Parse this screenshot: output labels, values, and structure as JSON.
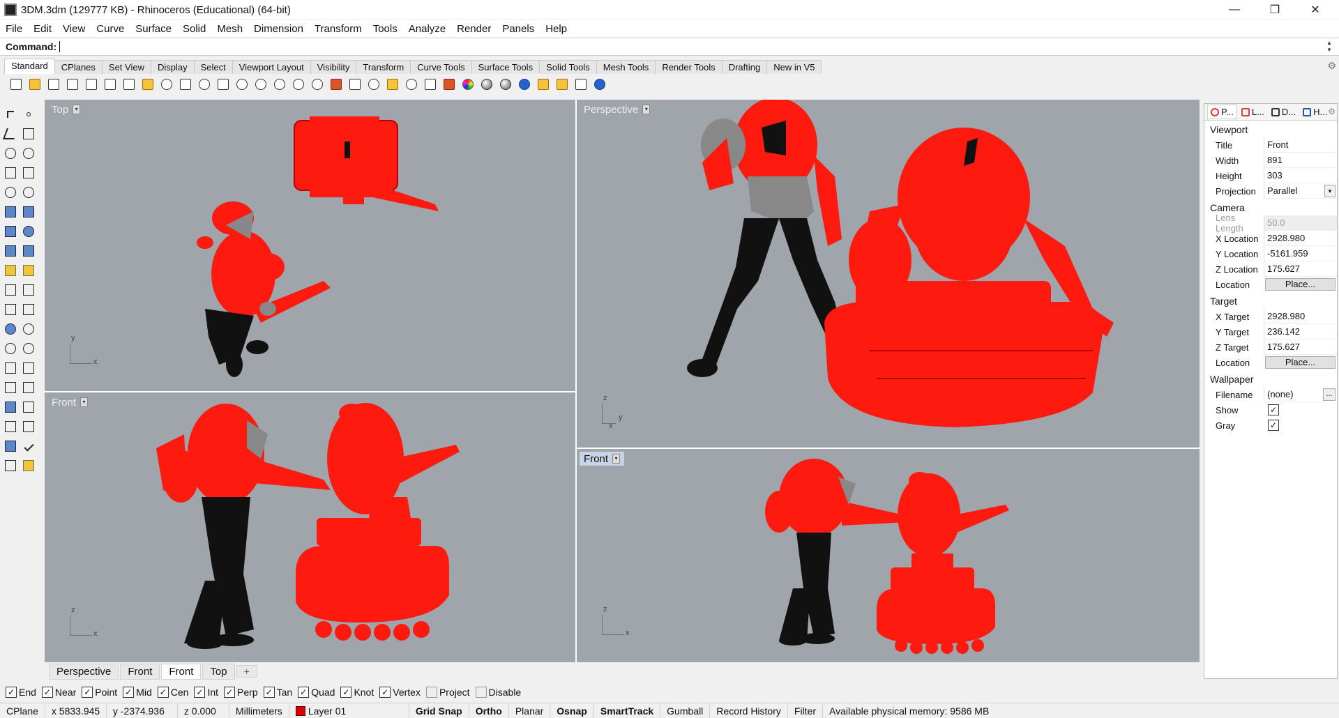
{
  "window": {
    "title": "3DM.3dm (129777 KB) - Rhinoceros (Educational) (64-bit)",
    "minimize": "—",
    "maximize": "❐",
    "close": "✕"
  },
  "menu": [
    "File",
    "Edit",
    "View",
    "Curve",
    "Surface",
    "Solid",
    "Mesh",
    "Dimension",
    "Transform",
    "Tools",
    "Analyze",
    "Render",
    "Panels",
    "Help"
  ],
  "command": {
    "label": "Command:",
    "value": ""
  },
  "toolbar_tabs": [
    "Standard",
    "CPlanes",
    "Set View",
    "Display",
    "Select",
    "Viewport Layout",
    "Visibility",
    "Transform",
    "Curve Tools",
    "Surface Tools",
    "Solid Tools",
    "Mesh Tools",
    "Render Tools",
    "Drafting",
    "New in V5"
  ],
  "toolbar_icons": [
    "new-icon",
    "open-icon",
    "save-icon",
    "print-icon",
    "import-icon",
    "cut-icon",
    "copy-icon",
    "paste-icon",
    "undo-icon",
    "pan-icon",
    "move-view-icon",
    "grid-icon",
    "zoom-icon",
    "zoom-window-icon",
    "zoom-extents-icon",
    "zoom-selected-icon",
    "rotate-view-icon",
    "car-icon",
    "plane-icon",
    "sun-icon",
    "shading-icon",
    "light-icon",
    "lock-icon",
    "render-icon",
    "color-wheel-icon",
    "material-sphere-icon",
    "grey-sphere-icon",
    "blue-sphere-icon",
    "filter-icon",
    "settings-icon",
    "dimension-icon",
    "help-icon"
  ],
  "viewports": {
    "top_left": {
      "label": "Top",
      "axis_a": "y",
      "axis_b": "x"
    },
    "bottom_left": {
      "label": "Front",
      "axis_a": "z",
      "axis_b": "x"
    },
    "top_right": {
      "label": "Perspective",
      "axis_a": "z",
      "axis_b": "y",
      "axis_c": "x"
    },
    "bottom_right": {
      "label": "Front",
      "axis_a": "z",
      "axis_b": "x"
    }
  },
  "viewport_tabs": [
    "Perspective",
    "Front",
    "Front",
    "Top"
  ],
  "viewport_tabs_active": 2,
  "panel": {
    "tabs": [
      "P...",
      "L...",
      "D...",
      "H..."
    ],
    "sections": {
      "viewport": "Viewport",
      "camera": "Camera",
      "target": "Target",
      "wallpaper": "Wallpaper"
    },
    "title_label": "Title",
    "title_value": "Front",
    "width_label": "Width",
    "width_value": "891",
    "height_label": "Height",
    "height_value": "303",
    "projection_label": "Projection",
    "projection_value": "Parallel",
    "lens_label": "Lens Length",
    "lens_value": "50.0",
    "xloc_label": "X Location",
    "xloc_value": "2928.980",
    "yloc_label": "Y Location",
    "yloc_value": "-5161.959",
    "zloc_label": "Z Location",
    "zloc_value": "175.627",
    "loc_label": "Location",
    "place_button": "Place...",
    "xt_label": "X Target",
    "xt_value": "2928.980",
    "yt_label": "Y Target",
    "yt_value": "236.142",
    "zt_label": "Z Target",
    "zt_value": "175.627",
    "tloc_label": "Location",
    "filename_label": "Filename",
    "filename_value": "(none)",
    "show_label": "Show",
    "show_checked": true,
    "gray_label": "Gray",
    "gray_checked": true
  },
  "osnaps": [
    {
      "label": "End",
      "checked": true
    },
    {
      "label": "Near",
      "checked": true
    },
    {
      "label": "Point",
      "checked": true
    },
    {
      "label": "Mid",
      "checked": true
    },
    {
      "label": "Cen",
      "checked": true
    },
    {
      "label": "Int",
      "checked": true
    },
    {
      "label": "Perp",
      "checked": true
    },
    {
      "label": "Tan",
      "checked": true
    },
    {
      "label": "Quad",
      "checked": true
    },
    {
      "label": "Knot",
      "checked": true
    },
    {
      "label": "Vertex",
      "checked": true
    },
    {
      "label": "Project",
      "checked": false
    },
    {
      "label": "Disable",
      "checked": false
    }
  ],
  "status": {
    "cplane": "CPlane",
    "x": "x 5833.945",
    "y": "y -2374.936",
    "z": "z 0.000",
    "units": "Millimeters",
    "layer": "Layer 01",
    "layer_color": "#dd0000",
    "grid_snap": "Grid Snap",
    "ortho": "Ortho",
    "planar": "Planar",
    "osnap": "Osnap",
    "smarttrack": "SmartTrack",
    "gumball": "Gumball",
    "record_history": "Record History",
    "filter": "Filter",
    "memory": "Available physical memory: 9586 MB"
  },
  "colors": {
    "viewport_bg": "#a0a4ab",
    "model_red": "#ff1a0f",
    "model_black": "#111111"
  }
}
